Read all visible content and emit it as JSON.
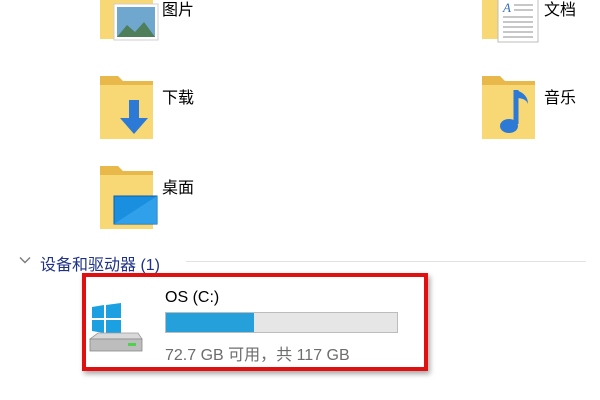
{
  "folders": [
    {
      "label": "图片",
      "icon": "pictures-folder-icon"
    },
    {
      "label": "文档",
      "icon": "documents-folder-icon"
    },
    {
      "label": "下载",
      "icon": "downloads-folder-icon"
    },
    {
      "label": "音乐",
      "icon": "music-folder-icon"
    },
    {
      "label": "桌面",
      "icon": "desktop-folder-icon"
    }
  ],
  "devices_section": {
    "title": "设备和驱动器 (1)",
    "expanded": true
  },
  "drive": {
    "name": "OS (C:)",
    "space_text": "72.7 GB 可用，共 117 GB",
    "free_gb": 72.7,
    "total_gb": 117,
    "used_fraction": 0.379,
    "highlighted": true
  },
  "colors": {
    "folder": "#f8d775",
    "usage_fill": "#26a0da",
    "highlight": "#e01010",
    "section_title": "#1e3287"
  }
}
